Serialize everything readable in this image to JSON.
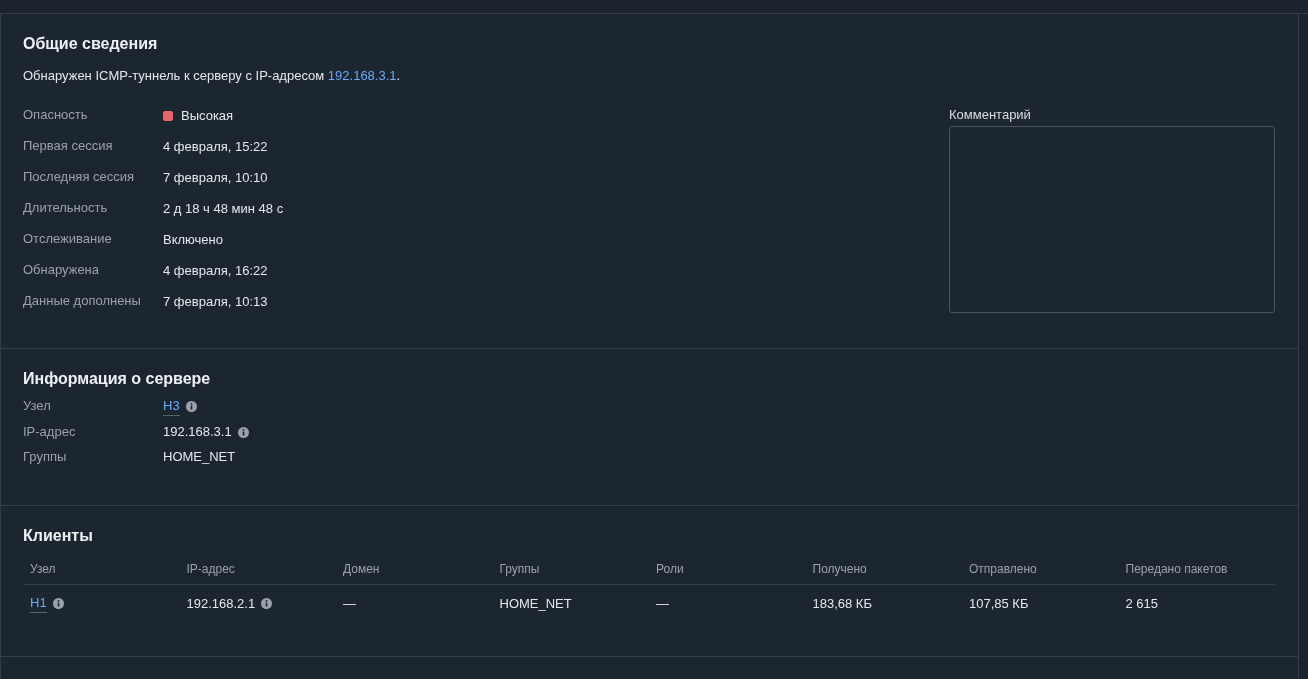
{
  "general": {
    "title": "Общие сведения",
    "summary": "Обнаружен ICMP-туннель к серверу с IP-адресом ",
    "summary_link": "192.168.3.1",
    "summary_end": ".",
    "fields": [
      {
        "label": "Опасность",
        "value": "Высокая",
        "color": "#e8636b"
      },
      {
        "label": "Первая сессия",
        "value": "4 февраля, 15:22"
      },
      {
        "label": "Последняя сессия",
        "value": "7 февраля, 10:10"
      },
      {
        "label": "Длительность",
        "value": "2 д 18 ч 48 мин 48 с"
      },
      {
        "label": "Отслеживание",
        "value": "Включено"
      },
      {
        "label": "Обнаружена",
        "value": "4 февраля, 16:22"
      },
      {
        "label": "Данные дополнены",
        "value": "7 февраля, 10:13"
      }
    ],
    "comment": {
      "label": "Комментарий"
    }
  },
  "server": {
    "title": "Информация о сервере",
    "fields": [
      {
        "label": "Узел",
        "value": "H3",
        "kind": "link"
      },
      {
        "label": "IP-адрес",
        "value": "192.168.3.1",
        "kind": "info"
      },
      {
        "label": "Группы",
        "value": "HOME_NET",
        "kind": "text"
      }
    ]
  },
  "clients": {
    "title": "Клиенты",
    "columns": [
      "Узел",
      "IP-адрес",
      "Домен",
      "Группы",
      "Роли",
      "Получено",
      "Отправлено",
      "Передано пакетов"
    ],
    "rows": [
      {
        "host": "H1",
        "ip": "192.168.2.1",
        "domain": "—",
        "groups": "HOME_NET",
        "roles": "—",
        "received": "183,68 КБ",
        "sent": "107,85 КБ",
        "packets": "2 615"
      }
    ]
  }
}
